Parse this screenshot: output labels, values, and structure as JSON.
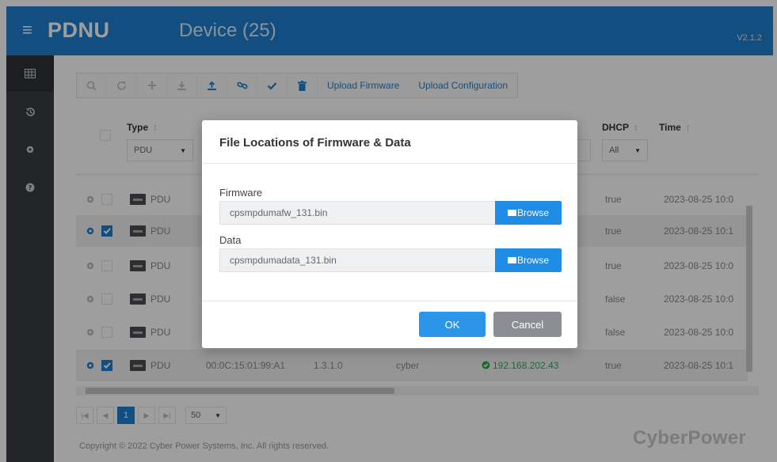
{
  "header": {
    "menu_icon": "hamburger-icon",
    "brand": "PDNU",
    "title": "Device (25)",
    "version": "V2.1.2"
  },
  "sidebar": {
    "items": [
      {
        "icon": "grid-icon",
        "active": true
      },
      {
        "icon": "history-icon",
        "active": false
      },
      {
        "icon": "gear-icon",
        "active": false
      },
      {
        "icon": "help-icon",
        "active": false
      }
    ]
  },
  "toolbar": {
    "icons": [
      "search-icon",
      "refresh-icon",
      "add-icon",
      "download-icon",
      "upload-icon",
      "link-icon",
      "check-icon",
      "trash-icon"
    ],
    "upload_firmware": "Upload Firmware",
    "upload_configuration": "Upload Configuration"
  },
  "table": {
    "columns": {
      "type": "Type",
      "dhcp": "DHCP",
      "time": "Time"
    },
    "filters": {
      "type": "PDU",
      "dhcp": "All"
    },
    "rows": [
      {
        "selected": false,
        "type": "PDU",
        "mac": "",
        "fw": "",
        "user": "",
        "ip": "",
        "dhcp": "true",
        "time": "2023-08-25 10:0"
      },
      {
        "selected": true,
        "type": "PDU",
        "mac": "",
        "fw": "",
        "user": "",
        "ip": "",
        "dhcp": "true",
        "time": "2023-08-25 10:1"
      },
      {
        "selected": false,
        "type": "PDU",
        "mac": "",
        "fw": "",
        "user": "",
        "ip": "",
        "dhcp": "true",
        "time": "2023-08-25 10:0"
      },
      {
        "selected": false,
        "type": "PDU",
        "mac": "",
        "fw": "",
        "user": "",
        "ip": "",
        "dhcp": "false",
        "time": "2023-08-25 10:0"
      },
      {
        "selected": false,
        "type": "PDU",
        "mac": "",
        "fw": "",
        "user": "",
        "ip": "",
        "dhcp": "false",
        "time": "2023-08-25 10:0"
      },
      {
        "selected": true,
        "type": "PDU",
        "mac": "00:0C:15:01:99:A1",
        "fw": "1.3.1.0",
        "user": "cyber",
        "ip": "192.168.202.43",
        "dhcp": "true",
        "time": "2023-08-25 10:1"
      }
    ]
  },
  "pager": {
    "current_page": "1",
    "page_size": "50"
  },
  "footer": {
    "copyright": "Copyright © 2022 Cyber Power Systems, Inc. All rights reserved.",
    "logo": "CyberPower"
  },
  "dialog": {
    "title": "File Locations of Firmware & Data",
    "firmware_label": "Firmware",
    "firmware_value": "cpsmpdumafw_131.bin",
    "data_label": "Data",
    "data_value": "cpsmpdumadata_131.bin",
    "browse_label": "Browse",
    "ok_label": "OK",
    "cancel_label": "Cancel"
  },
  "colors": {
    "primary": "#1f7fd1",
    "sidebar": "#3a3d42",
    "ok": "#2b95e9",
    "cancel": "#8b8f94",
    "online": "#2eaa4f"
  }
}
